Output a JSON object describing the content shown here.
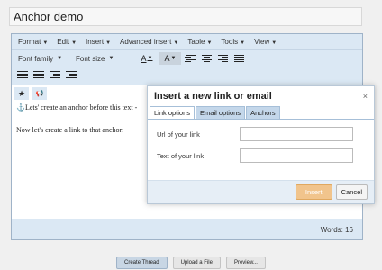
{
  "title_input": {
    "value": "Anchor demo"
  },
  "menubar": {
    "items": [
      "Format",
      "Edit",
      "Insert",
      "Advanced insert",
      "Table",
      "Tools",
      "View"
    ]
  },
  "toolbar": {
    "font_family": "Font family",
    "font_size": "Font size",
    "text_color_glyph": "A",
    "bg_color_glyph": "A",
    "star_glyph": "★",
    "megaphone_glyph": "📢"
  },
  "content": {
    "line1": "⚓Lets' create an anchor before this text -",
    "line2": "Now let's create a link to that anchor:"
  },
  "statusbar": {
    "words": "Words: 16"
  },
  "dialog": {
    "title": "Insert a new link or email",
    "close_glyph": "×",
    "tabs": [
      "Link options",
      "Email options",
      "Anchors"
    ],
    "url_label": "Url of your link",
    "text_label": "Text of your link",
    "url_value": "",
    "text_value": "",
    "insert_label": "Insert",
    "cancel_label": "Cancel"
  },
  "bottom_buttons": [
    "Create Thread",
    "Upload a File",
    "Preview..."
  ]
}
